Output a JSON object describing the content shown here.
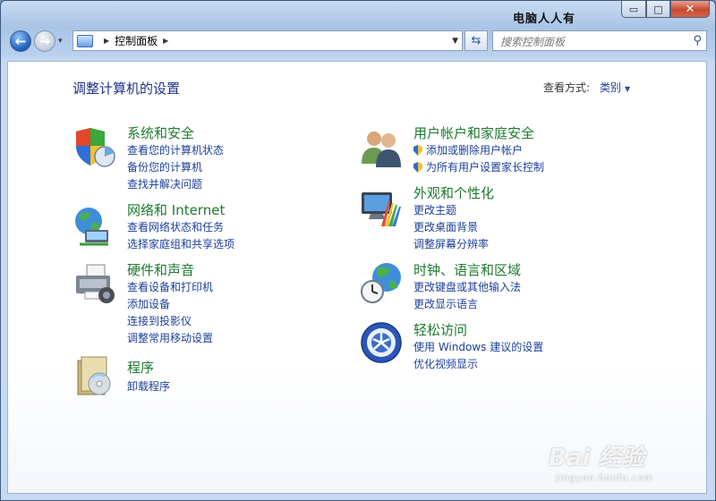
{
  "window": {
    "title": "电脑人人有",
    "minimize_glyph": "▭",
    "maximize_glyph": "□",
    "close_glyph": "✕"
  },
  "nav": {
    "back_glyph": "←",
    "forward_glyph": "→",
    "dropdown_glyph": "▾"
  },
  "address": {
    "path": "控制面板",
    "sep_glyph": "▶",
    "dropdown_glyph": "▼",
    "refresh_glyph": "⇆"
  },
  "search": {
    "placeholder": "搜索控制面板",
    "icon_glyph": "⚲"
  },
  "page": {
    "heading": "调整计算机的设置",
    "view_by_label": "查看方式:",
    "view_by_value": "类别",
    "view_by_arrow": "▼"
  },
  "categories_left": [
    {
      "title": "系统和安全",
      "icon": "system-security-icon",
      "links": [
        "查看您的计算机状态",
        "备份您的计算机",
        "查找并解决问题"
      ]
    },
    {
      "title": "网络和 Internet",
      "icon": "network-icon",
      "links": [
        "查看网络状态和任务",
        "选择家庭组和共享选项"
      ]
    },
    {
      "title": "硬件和声音",
      "icon": "hardware-sound-icon",
      "links": [
        "查看设备和打印机",
        "添加设备",
        "连接到投影仪",
        "调整常用移动设置"
      ]
    },
    {
      "title": "程序",
      "icon": "programs-icon",
      "links": [
        "卸载程序"
      ]
    }
  ],
  "categories_right": [
    {
      "title": "用户帐户和家庭安全",
      "icon": "user-accounts-icon",
      "links": [
        "添加或删除用户帐户",
        "为所有用户设置家长控制"
      ]
    },
    {
      "title": "外观和个性化",
      "icon": "appearance-icon",
      "links": [
        "更改主题",
        "更改桌面背景",
        "调整屏幕分辨率"
      ]
    },
    {
      "title": "时钟、语言和区域",
      "icon": "clock-language-icon",
      "links": [
        "更改键盘或其他输入法",
        "更改显示语言"
      ]
    },
    {
      "title": "轻松访问",
      "icon": "ease-of-access-icon",
      "links": [
        "使用 Windows 建议的设置",
        "优化视频显示"
      ]
    }
  ],
  "watermark": {
    "logo": "Bai 经验",
    "url": "jingyan.baidu.com"
  }
}
